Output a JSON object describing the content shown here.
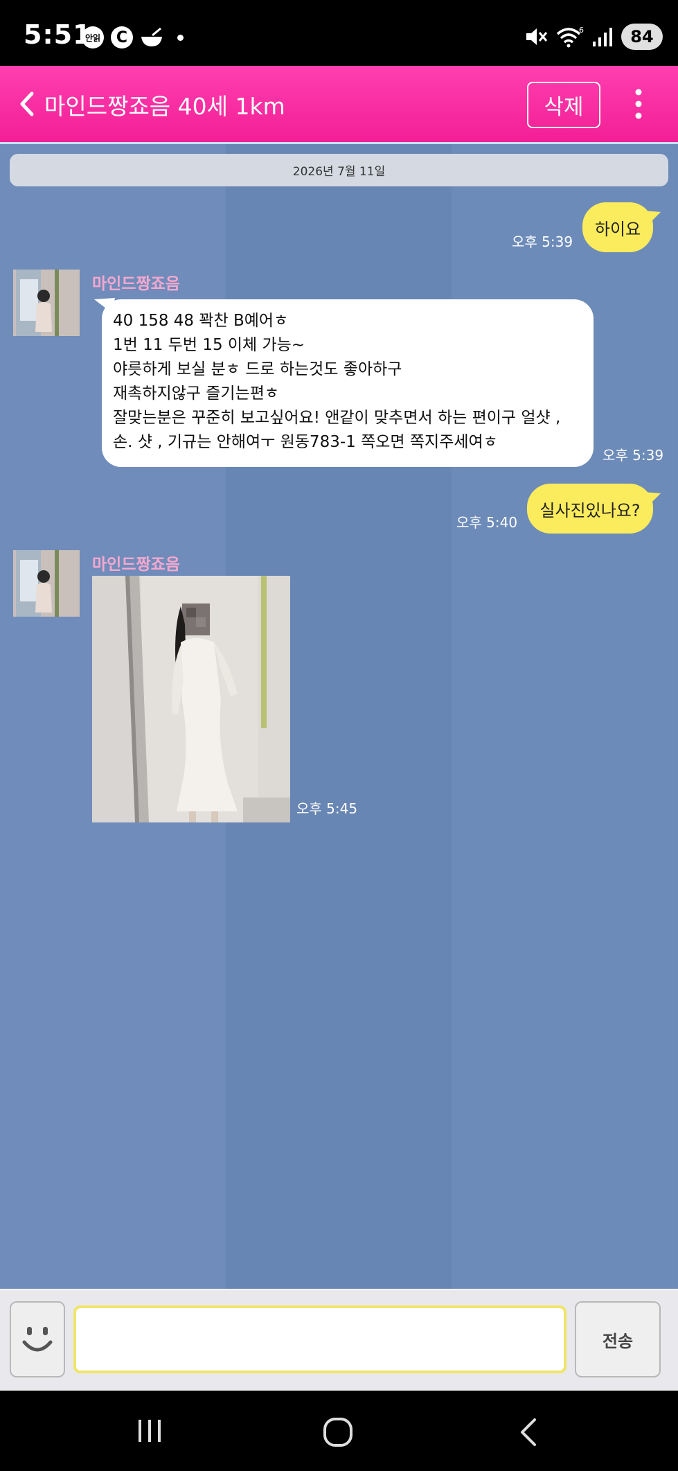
{
  "status_bar": {
    "time": "5:51",
    "app_badge_1": "안읽",
    "app_badge_2": "C",
    "battery": "84"
  },
  "header": {
    "title": "마인드짱죠음 40세 1km",
    "delete_label": "삭제"
  },
  "chat": {
    "date": "2026년 7월 11일",
    "messages": [
      {
        "side": "right",
        "text": "하이요",
        "time": "오후 5:39"
      },
      {
        "side": "left",
        "sender": "마인드짱죠음",
        "lines": [
          "40 158 48 꽉찬 B예어ㅎ",
          "1번 11 두번 15 이체 가능~",
          "야릇하게 보실 분ㅎ 드로 하는것도 좋아하구",
          "재촉하지않구 즐기는편ㅎ",
          "잘맞는분은 꾸준히 보고싶어요! 앤같이 맞추면서 하는 편이구 얼샷 ,",
          "손. 샷 , 기규는 안해여ㅜ 원동783-1 쪽오면 쪽지주세여ㅎ"
        ],
        "time": "오후 5:39"
      },
      {
        "side": "right",
        "text": "실사진있나요?",
        "time": "오후 5:40"
      },
      {
        "side": "left",
        "sender": "마인드짱죠음",
        "type": "photo",
        "time": "오후 5:45"
      }
    ]
  },
  "input": {
    "placeholder": "",
    "send_label": "전송"
  },
  "colors": {
    "header": "#f21f95",
    "chat_bg": "#6c8ab8",
    "my_bubble": "#fbec5d",
    "their_bubble": "#ffffff",
    "sender_name": "#f7a8cf"
  }
}
